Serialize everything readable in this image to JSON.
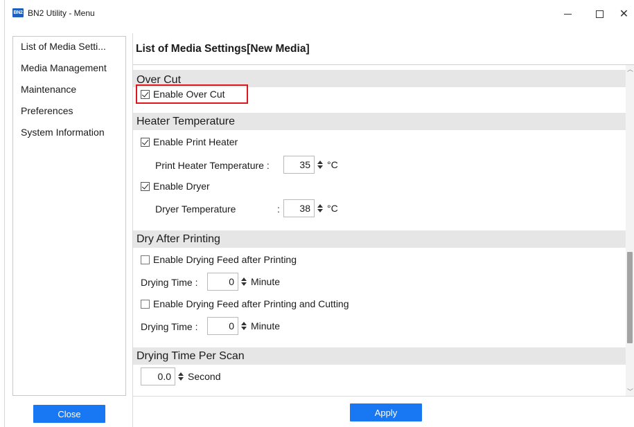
{
  "window": {
    "app_icon_text": "BN2",
    "title": "BN2 Utility - Menu",
    "controls": {
      "minimize": "minimize",
      "maximize": "maximize",
      "close_glyph": "✕"
    }
  },
  "sidebar": {
    "items": [
      {
        "label": "List of Media Setti..."
      },
      {
        "label": "Media Management"
      },
      {
        "label": "Maintenance"
      },
      {
        "label": "Preferences"
      },
      {
        "label": "System Information"
      }
    ],
    "close_button": "Close"
  },
  "main": {
    "title": "List of Media Settings[New Media]",
    "over_cut": {
      "header": "Over Cut",
      "enable_label": "Enable Over Cut",
      "enable_checked": true
    },
    "heater": {
      "header": "Heater Temperature",
      "print_heater_label": "Enable Print Heater",
      "print_heater_checked": true,
      "print_heater_temp_label": "Print Heater Temperature :",
      "print_heater_temp_value": "35",
      "print_heater_temp_unit": "°C",
      "dryer_label": "Enable Dryer",
      "dryer_checked": true,
      "dryer_temp_label": "Dryer Temperature",
      "dryer_temp_colon": ":",
      "dryer_temp_value": "38",
      "dryer_temp_unit": "°C"
    },
    "dry_after": {
      "header": "Dry After Printing",
      "feed_label": "Enable Drying Feed after Printing",
      "feed_checked": false,
      "time1_label": "Drying Time :",
      "time1_value": "0",
      "time1_unit": "Minute",
      "feed_cut_label": "Enable Drying Feed after Printing and Cutting",
      "feed_cut_checked": false,
      "time2_label": "Drying Time :",
      "time2_value": "0",
      "time2_unit": "Minute"
    },
    "per_scan": {
      "header": "Drying Time Per Scan",
      "value": "0.0",
      "unit": "Second"
    },
    "apply_button": "Apply"
  },
  "colors": {
    "button_blue": "#1877f2",
    "highlight_red": "#e0141b",
    "section_gray": "#e6e6e6"
  }
}
